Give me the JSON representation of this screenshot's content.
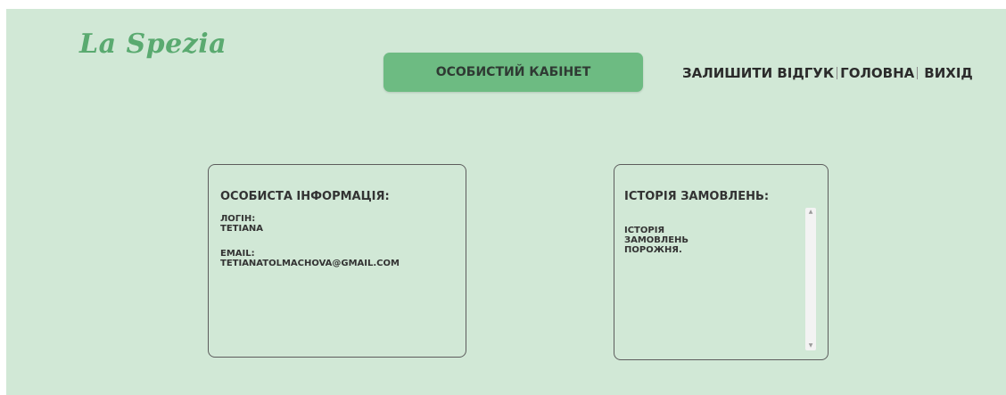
{
  "header": {
    "logo_text": "La Spezia",
    "cabinet_button_label": "ОСОБИСТИЙ КАБІНЕТ",
    "nav": {
      "review": "ЗАЛИШИТИ ВІДГУК",
      "home": "ГОЛОВНА",
      "logout": "ВИХІД"
    }
  },
  "personal_info": {
    "title": "ОСОБИСТА ІНФОРМАЦІЯ:",
    "login_label": "ЛОГІН:",
    "login_value": "TETIANA",
    "email_label": "EMAIL:",
    "email_value": "TETIANATOLMACHOVA@GMAIL.COM"
  },
  "order_history": {
    "title": "ІСТОРІЯ ЗАМОВЛЕНЬ:",
    "empty_text": "ІСТОРІЯ ЗАМОВЛЕНЬ ПОРОЖНЯ."
  },
  "colors": {
    "background": "#d1e8d6",
    "accent": "#6dbb82",
    "logo": "#5aaa70",
    "border": "#5d5d5d"
  }
}
